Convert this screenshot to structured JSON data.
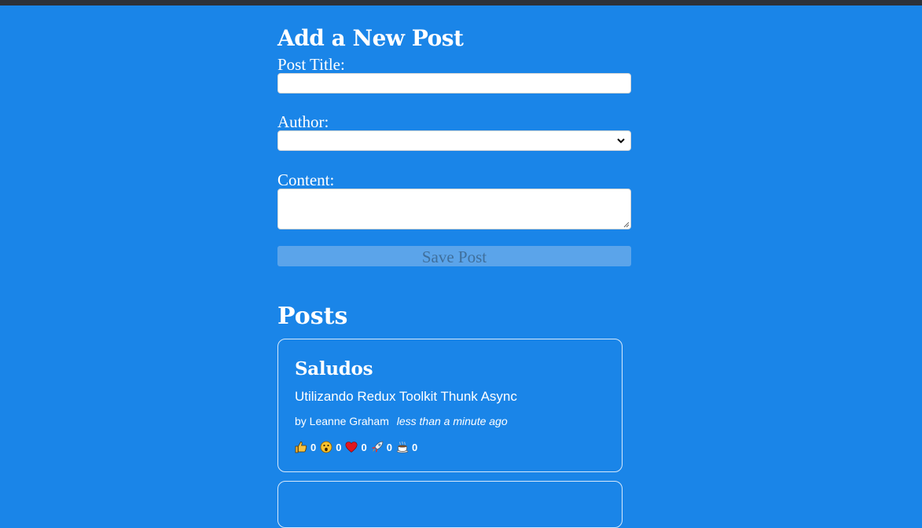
{
  "form": {
    "heading": "Add a New Post",
    "title_label": "Post Title:",
    "title_value": "",
    "author_label": "Author:",
    "author_selected": "",
    "content_label": "Content:",
    "content_value": "",
    "save_label": "Save Post"
  },
  "posts": {
    "heading": "Posts",
    "items": [
      {
        "title": "Saludos",
        "content": "Utilizando Redux Toolkit Thunk Async",
        "author": "by Leanne Graham",
        "time": "less than a minute ago",
        "reactions": [
          {
            "icon": "thumbs-up-icon",
            "count": "0"
          },
          {
            "icon": "wow-icon",
            "count": "0"
          },
          {
            "icon": "heart-icon",
            "count": "0"
          },
          {
            "icon": "rocket-icon",
            "count": "0"
          },
          {
            "icon": "coffee-icon",
            "count": "0"
          }
        ]
      }
    ]
  },
  "colors": {
    "background": "#1a85e8",
    "top_bar": "#2d3139",
    "card_border": "#d7e9fb",
    "disabled_button": "#5ba4ea"
  }
}
